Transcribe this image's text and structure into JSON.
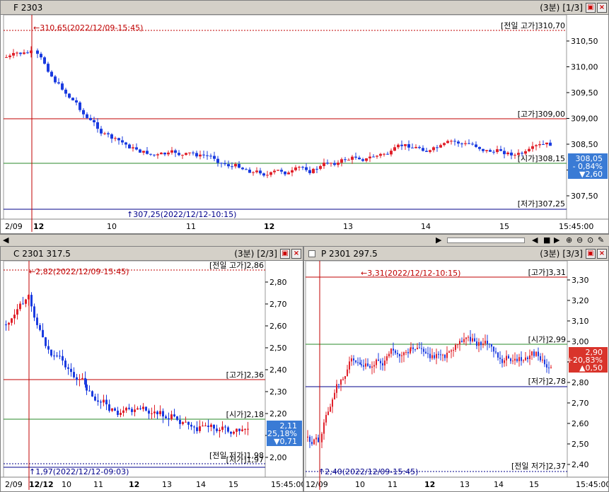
{
  "main": {
    "title": "F 2303",
    "period": "(3분)",
    "page": "[1/3]",
    "y_ticks": [
      "310,50",
      "310,00",
      "309,50",
      "309,00",
      "308,50",
      "308,00",
      "307,50"
    ],
    "x_ticks": [
      "2/09",
      "12",
      "10",
      "11",
      "12",
      "13",
      "14",
      "15",
      "15:45:00"
    ],
    "prev_high": "[전일 고가]310,70",
    "high": "[고가]309,00",
    "open": "[시가]308,15",
    "low": "[저가]307,25",
    "max_label": "310,65(2022/12/09-15:45)",
    "min_label": "307,25(2022/12/12-10:15)",
    "badge": {
      "price": "308,05",
      "pct": "- 0,84%",
      "chg": "▼2,60"
    }
  },
  "call": {
    "title": "C 2301 317.5",
    "period": "(3분)",
    "page": "[2/3]",
    "y_ticks": [
      "2,80",
      "2,70",
      "2,60",
      "2,50",
      "2,40",
      "2,30",
      "2,20",
      "2,10",
      "2,00"
    ],
    "x_ticks": [
      "2/09",
      "12/12",
      "10",
      "11",
      "12",
      "13",
      "14",
      "15",
      "15:45:00"
    ],
    "prev_high": "[전일 고가]2,86",
    "high": "[고가]2,36",
    "open": "[시가]2,18",
    "low": "[저가]1,97",
    "prev_low": "[전일 저가]1,98",
    "max_label": "2,82(2022/12/09-15:45)",
    "min_label": "1,97(2022/12/12-09:03)",
    "badge": {
      "price": "2,11",
      "pct": "- 25,18%",
      "chg": "▼0,71"
    }
  },
  "put": {
    "title": "P 2301 297.5",
    "period": "(3분)",
    "page": "[3/3]",
    "y_ticks": [
      "3,30",
      "3,20",
      "3,10",
      "3,00",
      "2,90",
      "2,80",
      "2,70",
      "2,60",
      "2,50",
      "2,40"
    ],
    "x_ticks": [
      "12/09",
      "10",
      "11",
      "12",
      "13",
      "14",
      "15",
      "15:45:00"
    ],
    "high": "[고가]3,31",
    "open": "[시가]2,99",
    "low": "[저가]2,78",
    "prev_low": "[전일 저가]2,37",
    "max_label": "3,31(2022/12/12-10:15)",
    "min_label": "2,40(2022/12/09-15:45)",
    "badge": {
      "price": "2,90",
      "pct": "+20,83%",
      "chg": "▲0,50"
    }
  },
  "colors": {
    "up": "#e0202a",
    "down": "#1a3be0",
    "green": "#2a8a2a",
    "red_line": "#c00000",
    "blue_line": "#00008b",
    "badge_blue": "#3a7bd5",
    "badge_red": "#d9342b"
  },
  "icons": [
    "zoom-in-icon",
    "zoom-out-icon",
    "reset-icon",
    "wrench-icon",
    "play-icon",
    "stop-icon",
    "prev-icon",
    "next-icon"
  ]
}
